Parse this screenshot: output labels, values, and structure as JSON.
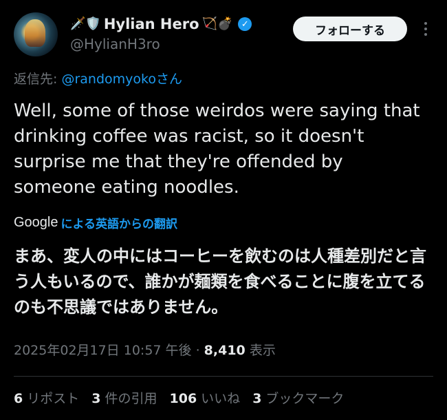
{
  "author": {
    "display_name": "Hylian Hero",
    "prefix_emoji": "🗡️🛡️",
    "suffix_emoji": "🏹💣",
    "verified_mark": "✓",
    "handle": "@HylianH3ro"
  },
  "follow_label": "フォローする",
  "reply": {
    "prefix": "返信先: ",
    "mention": "@randomyoko",
    "suffix": "さん"
  },
  "text": "Well, some of those weirdos were saying that drinking coffee was racist, so it doesn't surprise me that they're offended by someone eating noodles.",
  "translation": {
    "provider": "Google",
    "label": "による英語からの翻訳",
    "text": "まあ、変人の中にはコーヒーを飲むのは人種差別だと言う人もいるので、誰かが麺類を食べることに腹を立てるのも不思議ではありません。"
  },
  "meta": {
    "timestamp": "2025年02月17日 10:57 午後",
    "separator": " · ",
    "views": "8,410",
    "views_label": " 表示"
  },
  "stats": [
    {
      "num": "6",
      "label": "リポスト"
    },
    {
      "num": "3",
      "label": "件の引用"
    },
    {
      "num": "106",
      "label": "いいね"
    },
    {
      "num": "3",
      "label": "ブックマーク"
    }
  ],
  "colors": {
    "background": "#000000",
    "text": "#e7e9ea",
    "secondary": "#71767b",
    "accent": "#1d9bf0"
  },
  "icons": [
    "more-options-icon",
    "verified-badge-icon"
  ]
}
